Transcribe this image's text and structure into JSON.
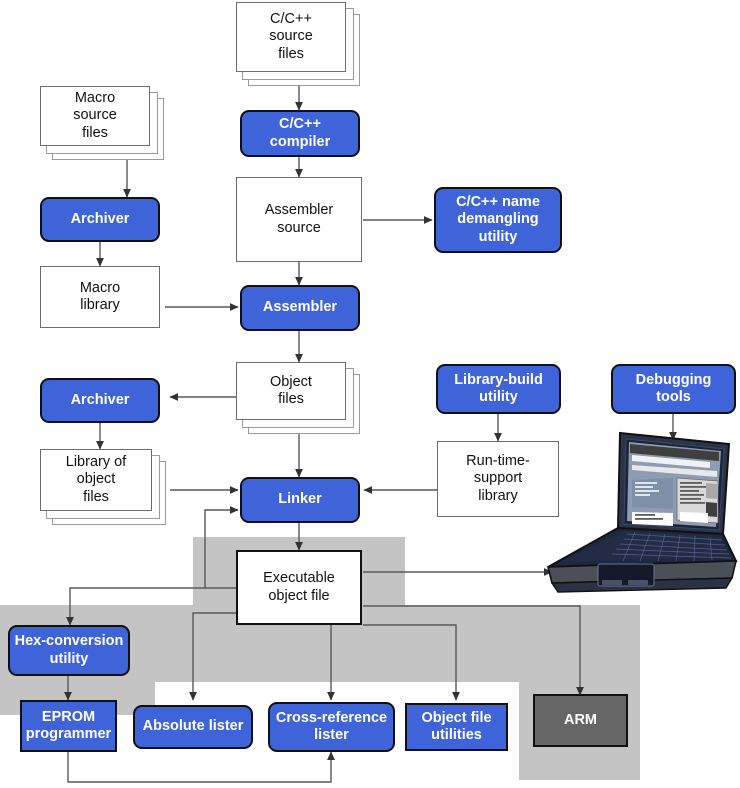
{
  "diagram": {
    "title": "TI code generation tools software development flow",
    "colors": {
      "process_blue": "#3f63d8",
      "band_gray": "#c4c4c4",
      "target_gray": "#666666",
      "line": "#4a4a4a",
      "text_dark": "#111111",
      "text_light": "#ffffff"
    },
    "nodes": {
      "c_source_files": {
        "label": "C/C++\nsource\nfiles",
        "kind": "document-stack"
      },
      "cpp_compiler": {
        "label": "C/C++\ncompiler",
        "kind": "process"
      },
      "macro_source_files": {
        "label": "Macro\nsource\nfiles",
        "kind": "document-stack"
      },
      "archiver_macro": {
        "label": "Archiver",
        "kind": "process"
      },
      "macro_library": {
        "label": "Macro\nlibrary",
        "kind": "document"
      },
      "assembler_source": {
        "label": "Assembler\nsource",
        "kind": "document"
      },
      "name_demangling": {
        "label": "C/C++ name\ndemangling\nutility",
        "kind": "process"
      },
      "assembler": {
        "label": "Assembler",
        "kind": "process"
      },
      "object_files": {
        "label": "Object\nfiles",
        "kind": "document-stack"
      },
      "archiver_object": {
        "label": "Archiver",
        "kind": "process"
      },
      "library_of_object_files": {
        "label": "Library of\nobject\nfiles",
        "kind": "document-stack"
      },
      "library_build_utility": {
        "label": "Library-build\nutility",
        "kind": "process"
      },
      "runtime_support_library": {
        "label": "Run-time-\nsupport\nlibrary",
        "kind": "document"
      },
      "debugging_tools": {
        "label": "Debugging\ntools",
        "kind": "process"
      },
      "linker": {
        "label": "Linker",
        "kind": "process"
      },
      "executable_object_file": {
        "label": "Executable\nobject file",
        "kind": "document-heavy"
      },
      "hex_conversion_utility": {
        "label": "Hex-conversion\nutility",
        "kind": "process"
      },
      "eprom_programmer": {
        "label": "EPROM\nprogrammer",
        "kind": "process-square"
      },
      "absolute_lister": {
        "label": "Absolute lister",
        "kind": "process"
      },
      "cross_reference_lister": {
        "label": "Cross-reference\nlister",
        "kind": "process"
      },
      "object_file_utilities": {
        "label": "Object file\nutilities",
        "kind": "process-square"
      },
      "arm_target": {
        "label": "ARM",
        "kind": "target"
      },
      "laptop": {
        "label": "debugger-laptop",
        "kind": "illustration"
      }
    }
  }
}
